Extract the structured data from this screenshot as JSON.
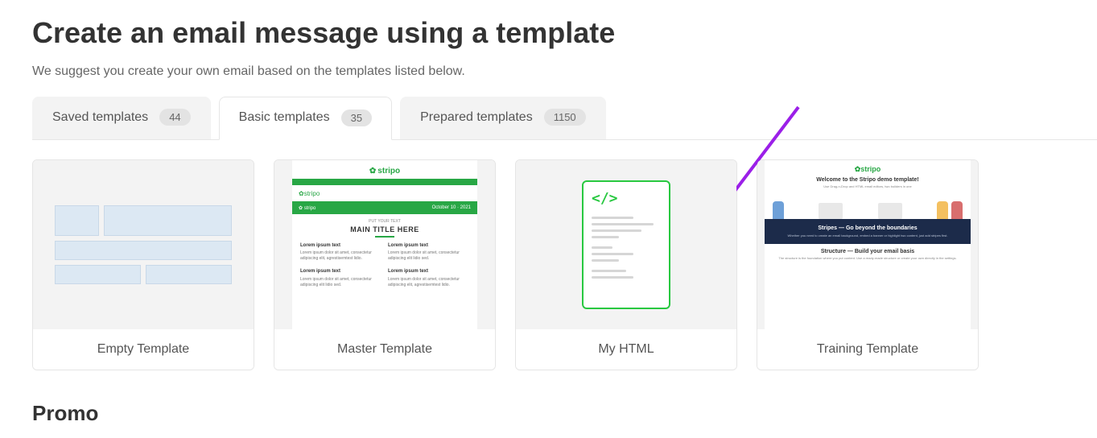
{
  "page": {
    "title": "Create an email message using a template",
    "subtitle": "We suggest you create your own email based on the templates listed below."
  },
  "tabs": [
    {
      "label": "Saved templates",
      "count": "44",
      "active": false
    },
    {
      "label": "Basic templates",
      "count": "35",
      "active": true
    },
    {
      "label": "Prepared templates",
      "count": "1150",
      "active": false
    }
  ],
  "cards": {
    "empty": {
      "label": "Empty Template"
    },
    "master": {
      "label": "Master Template",
      "logo": "stripo",
      "brand": "stripo",
      "sub_left": "✿ stripo",
      "sub_right": "October 10 · 2021",
      "pretitle": "PUT YOUR TEXT",
      "title": "MAIN TITLE HERE",
      "col_head": "Lorem ipsum text",
      "col_body1": "Lorem ipsum dolor sit amet, consectetur adipiscing elit, agrestisemtest lidio.",
      "col_body2": "Lorem ipsum dolor sit amet, consectetur adipiscing elit lidio sed."
    },
    "myhtml": {
      "label": "My HTML",
      "icon": "</>"
    },
    "training": {
      "label": "Training Template",
      "logo": "stripo",
      "welcome": "Welcome to the Stripo demo template!",
      "welcome_sub": "Use Drag-n-Drop and HTML email editors, two builders in one",
      "band_title": "Stripes — Go beyond the boundaries",
      "band_sub": "Whether you need to create an email background, embed a banner or highlight two content, just add stripes first.",
      "struct_title": "Structure — Build your email basis",
      "struct_sub": "The structure is the foundation where you put content. Use a ready-made structure or create your own directly in the settings."
    }
  },
  "sections": {
    "promo": "Promo"
  },
  "colors": {
    "accent": "#28a745",
    "arrow": "#9b1fe8"
  }
}
